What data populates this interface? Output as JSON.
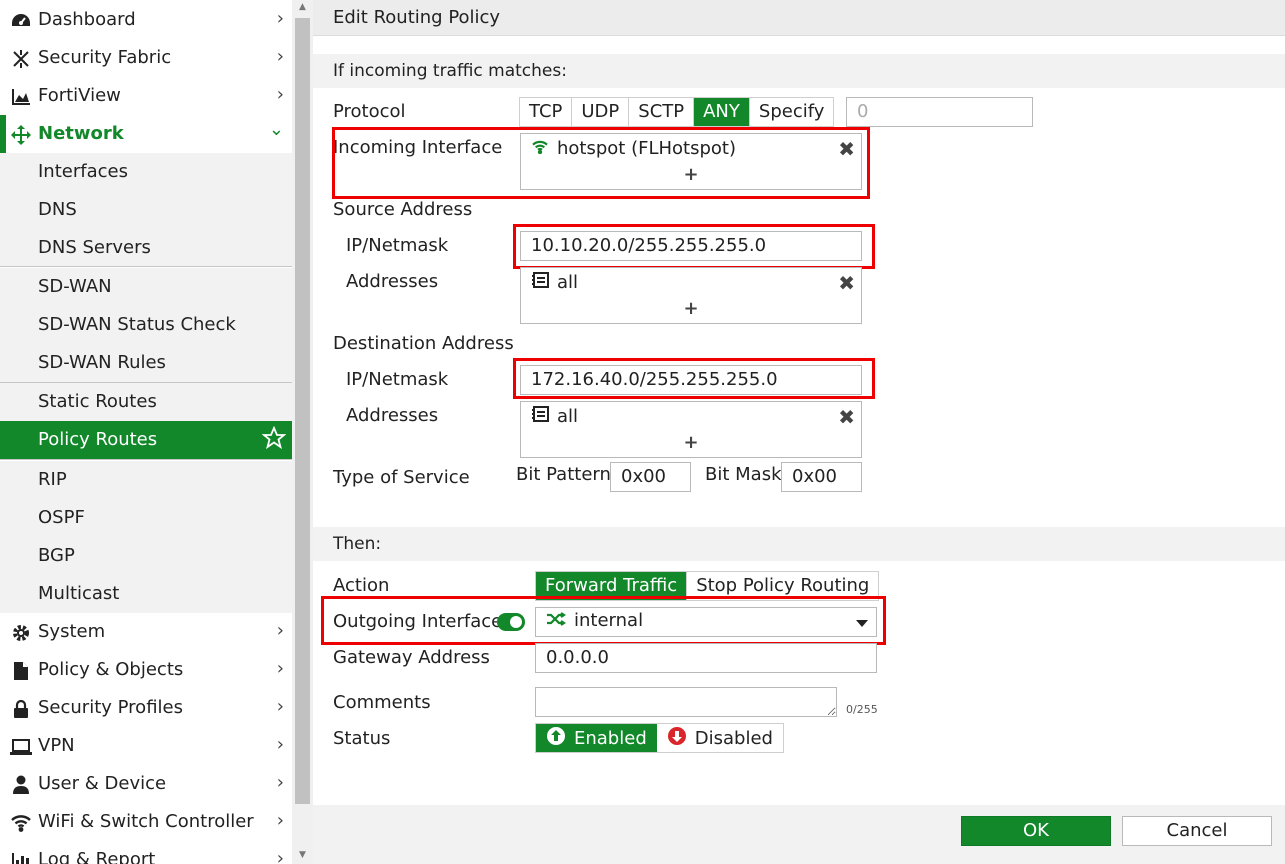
{
  "sidebar": {
    "items": [
      {
        "label": "Dashboard",
        "icon": "dashboard-icon"
      },
      {
        "label": "Security Fabric",
        "icon": "security-fabric-icon"
      },
      {
        "label": "FortiView",
        "icon": "fortiview-icon"
      },
      {
        "label": "Network",
        "icon": "network-icon",
        "expanded": true
      },
      {
        "label": "System",
        "icon": "gear-icon"
      },
      {
        "label": "Policy & Objects",
        "icon": "policy-objects-icon"
      },
      {
        "label": "Security Profiles",
        "icon": "lock-icon"
      },
      {
        "label": "VPN",
        "icon": "laptop-icon"
      },
      {
        "label": "User & Device",
        "icon": "user-icon"
      },
      {
        "label": "WiFi & Switch Controller",
        "icon": "wifi-icon"
      },
      {
        "label": "Log & Report",
        "icon": "bar-chart-icon"
      }
    ],
    "network_sub": [
      {
        "label": "Interfaces"
      },
      {
        "label": "DNS"
      },
      {
        "label": "DNS Servers"
      },
      {
        "label": "SD-WAN"
      },
      {
        "label": "SD-WAN Status Check"
      },
      {
        "label": "SD-WAN Rules"
      },
      {
        "label": "Static Routes"
      },
      {
        "label": "Policy Routes",
        "active": true
      },
      {
        "label": "RIP"
      },
      {
        "label": "OSPF"
      },
      {
        "label": "BGP"
      },
      {
        "label": "Multicast"
      }
    ]
  },
  "page": {
    "title": "Edit Routing Policy",
    "match_heading": "If incoming traffic matches:",
    "protocol": {
      "label": "Protocol",
      "options": [
        "TCP",
        "UDP",
        "SCTP",
        "ANY",
        "Specify"
      ],
      "selected": "ANY",
      "number_value": "0"
    },
    "incoming_interface": {
      "label": "Incoming Interface",
      "value": "hotspot (FLHotspot)"
    },
    "source": {
      "label": "Source Address",
      "ipmask_label": "IP/Netmask",
      "ipmask_value": "10.10.20.0/255.255.255.0",
      "addresses_label": "Addresses",
      "addresses_value": "all"
    },
    "destination": {
      "label": "Destination Address",
      "ipmask_label": "IP/Netmask",
      "ipmask_value": "172.16.40.0/255.255.255.0",
      "addresses_label": "Addresses",
      "addresses_value": "all"
    },
    "tos": {
      "label": "Type of Service",
      "bit_pattern_label": "Bit Pattern",
      "bit_pattern_value": "0x00",
      "bit_mask_label": "Bit Mask",
      "bit_mask_value": "0x00"
    },
    "then_heading": "Then:",
    "action": {
      "label": "Action",
      "options": [
        "Forward Traffic",
        "Stop Policy Routing"
      ],
      "selected": "Forward Traffic"
    },
    "outgoing_interface": {
      "label": "Outgoing Interface",
      "enabled": true,
      "value": "internal"
    },
    "gateway": {
      "label": "Gateway Address",
      "value": "0.0.0.0"
    },
    "comments": {
      "label": "Comments",
      "value": "",
      "counter": "0/255"
    },
    "status": {
      "label": "Status",
      "enabled_label": "Enabled",
      "disabled_label": "Disabled",
      "selected": "Enabled"
    },
    "buttons": {
      "ok": "OK",
      "cancel": "Cancel"
    }
  },
  "colors": {
    "accent": "#12882a",
    "highlight": "#ee0000",
    "disabled_icon": "#d9262a"
  }
}
